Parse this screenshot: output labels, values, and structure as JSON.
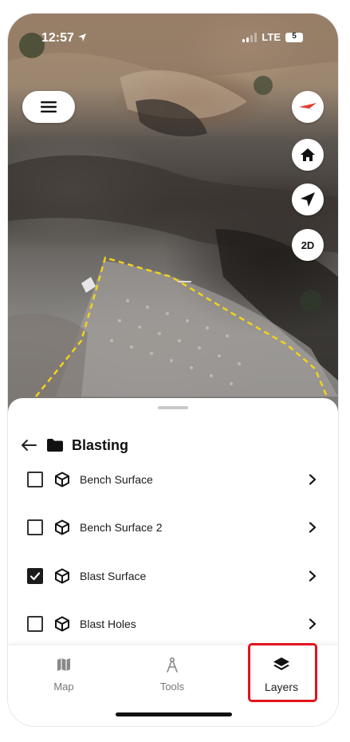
{
  "status_bar": {
    "time": "12:57",
    "network": "LTE",
    "battery": "5"
  },
  "map": {
    "menu_icon": "hamburger-icon",
    "controls": [
      {
        "name": "compass",
        "icon": "compass-icon"
      },
      {
        "name": "home",
        "icon": "home-icon"
      },
      {
        "name": "locate",
        "icon": "location-arrow-icon"
      },
      {
        "name": "view_mode",
        "label": "2D"
      }
    ],
    "boundary_color": "#f2d21a"
  },
  "sheet": {
    "folder_title": "Blasting",
    "layers": [
      {
        "label": "Bench Surface",
        "checked": false
      },
      {
        "label": "Bench Surface 2",
        "checked": false
      },
      {
        "label": "Blast Surface",
        "checked": true
      },
      {
        "label": "Blast Holes",
        "checked": false
      }
    ]
  },
  "tabbar": {
    "tabs": [
      {
        "label": "Map",
        "icon": "map-icon"
      },
      {
        "label": "Tools",
        "icon": "compass-drafting-icon"
      },
      {
        "label": "Layers",
        "icon": "layers-icon",
        "selected": true
      }
    ],
    "highlight_color": "#e0141e"
  }
}
